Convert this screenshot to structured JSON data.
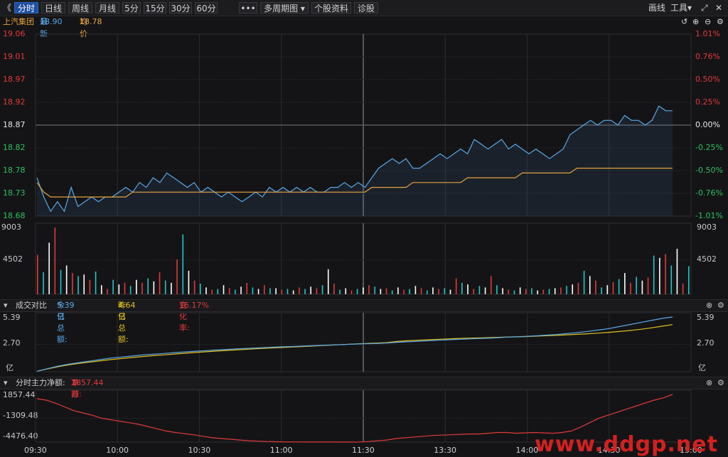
{
  "toolbar": {
    "back_glyph": "《",
    "tabs": [
      "分时",
      "日线",
      "周线",
      "月线",
      "5分",
      "15分",
      "30分",
      "60分"
    ],
    "active_tab": 0,
    "more": "•••",
    "multi_period": "多周期图",
    "stock_info": "个股资料",
    "diagnose": "诊股",
    "draw_line": "画线",
    "tools": "工具",
    "icon_expand": "expand-icon",
    "icon_close": "close-icon"
  },
  "quote": {
    "name": "上汽集团",
    "latest_label": "最新",
    "latest": "18.90",
    "avg_label": "均价",
    "avg": "18.78"
  },
  "price_axis": {
    "left": [
      "19.06",
      "19.01",
      "18.97",
      "18.92",
      "18.87",
      "18.82",
      "18.78",
      "18.73",
      "18.68"
    ],
    "right": [
      "1.01%",
      "0.76%",
      "0.50%",
      "0.25%",
      "0.00%",
      "-0.25%",
      "-0.50%",
      "-0.76%",
      "-1.01%"
    ],
    "prev_close": 18.87,
    "min": 18.68,
    "max": 19.06
  },
  "volume_axis": {
    "labels": [
      "9003",
      "4502"
    ],
    "max": 9003
  },
  "turnover_panel": {
    "title": "成交对比",
    "today_label": "今日总额:",
    "today": "5.39亿",
    "yesterday_label": "昨日总额:",
    "yesterday": "4.64亿",
    "change_label": "变化率:",
    "change": "16.17%",
    "axis": [
      "5.39",
      "2.70",
      "亿"
    ],
    "max": 5.39
  },
  "flow_panel": {
    "title": "分时主力净额:",
    "net_label": "净额:",
    "net": "1857.44万",
    "arrow": "↑",
    "axis": [
      "1857.44",
      "-1309.48",
      "-4476.40"
    ],
    "max": 1857.44,
    "min": -4476.4
  },
  "time_axis": [
    "09:30",
    "10:00",
    "10:30",
    "11:00",
    "11:30",
    "13:30",
    "14:00",
    "14:30",
    "15:00"
  ],
  "colors": {
    "up": "#e03a3a",
    "down": "#1ec8c8",
    "price": "#5aa8e8",
    "avg": "#e6a23c",
    "yesterday": "#e0c020",
    "neutral": "#ffffff"
  },
  "chart_data": {
    "type": "line",
    "x_ticks": [
      "09:30",
      "10:00",
      "10:30",
      "11:00",
      "11:30",
      "13:30",
      "14:00",
      "14:30",
      "15:00"
    ],
    "price": [
      18.76,
      18.72,
      18.69,
      18.71,
      18.69,
      18.74,
      18.7,
      18.71,
      18.72,
      18.71,
      18.72,
      18.72,
      18.73,
      18.74,
      18.73,
      18.75,
      18.74,
      18.76,
      18.75,
      18.77,
      18.76,
      18.75,
      18.74,
      18.75,
      18.73,
      18.74,
      18.73,
      18.72,
      18.73,
      18.72,
      18.71,
      18.72,
      18.73,
      18.72,
      18.74,
      18.73,
      18.74,
      18.73,
      18.74,
      18.73,
      18.74,
      18.73,
      18.73,
      18.74,
      18.74,
      18.75,
      18.74,
      18.75,
      18.74,
      18.76,
      18.78,
      18.79,
      18.8,
      18.79,
      18.8,
      18.78,
      18.78,
      18.79,
      18.8,
      18.81,
      18.8,
      18.81,
      18.82,
      18.81,
      18.84,
      18.83,
      18.82,
      18.83,
      18.84,
      18.82,
      18.83,
      18.82,
      18.81,
      18.82,
      18.81,
      18.8,
      18.81,
      18.82,
      18.85,
      18.86,
      18.87,
      18.88,
      18.87,
      18.88,
      18.88,
      18.87,
      18.89,
      18.88,
      18.88,
      18.87,
      18.88,
      18.91,
      18.9,
      18.9
    ],
    "avg": [
      18.75,
      18.73,
      18.72,
      18.72,
      18.72,
      18.72,
      18.72,
      18.72,
      18.72,
      18.72,
      18.72,
      18.72,
      18.72,
      18.72,
      18.73,
      18.73,
      18.73,
      18.73,
      18.73,
      18.73,
      18.73,
      18.73,
      18.73,
      18.73,
      18.73,
      18.73,
      18.73,
      18.73,
      18.73,
      18.73,
      18.73,
      18.73,
      18.73,
      18.73,
      18.73,
      18.73,
      18.73,
      18.73,
      18.73,
      18.73,
      18.73,
      18.73,
      18.73,
      18.73,
      18.73,
      18.73,
      18.73,
      18.73,
      18.73,
      18.74,
      18.74,
      18.74,
      18.74,
      18.74,
      18.74,
      18.75,
      18.75,
      18.75,
      18.75,
      18.75,
      18.75,
      18.75,
      18.75,
      18.76,
      18.76,
      18.76,
      18.76,
      18.76,
      18.76,
      18.76,
      18.76,
      18.77,
      18.77,
      18.77,
      18.77,
      18.77,
      18.77,
      18.77,
      18.77,
      18.78,
      18.78,
      18.78,
      18.78,
      18.78,
      18.78,
      18.78,
      18.78,
      18.78,
      18.78,
      18.78,
      18.78,
      18.78,
      18.78,
      18.78
    ],
    "turnover_today": [
      0.05,
      0.3,
      0.55,
      0.75,
      0.9,
      1.05,
      1.2,
      1.35,
      1.45,
      1.55,
      1.65,
      1.72,
      1.8,
      1.88,
      1.95,
      2.02,
      2.08,
      2.14,
      2.2,
      2.26,
      2.3,
      2.35,
      2.4,
      2.45,
      2.48,
      2.52,
      2.56,
      2.6,
      2.64,
      2.68,
      2.72,
      2.75,
      2.78,
      2.82,
      2.9,
      2.95,
      3.0,
      3.05,
      3.1,
      3.15,
      3.2,
      3.24,
      3.28,
      3.32,
      3.38,
      3.43,
      3.48,
      3.53,
      3.6,
      3.66,
      3.75,
      3.85,
      3.97,
      4.1,
      4.25,
      4.45,
      4.65,
      4.85,
      5.05,
      5.25,
      5.39
    ],
    "turnover_yesterday": [
      0.05,
      0.28,
      0.5,
      0.68,
      0.82,
      0.95,
      1.08,
      1.2,
      1.3,
      1.4,
      1.5,
      1.58,
      1.66,
      1.74,
      1.82,
      1.9,
      1.97,
      2.04,
      2.1,
      2.16,
      2.22,
      2.28,
      2.33,
      2.38,
      2.43,
      2.48,
      2.53,
      2.58,
      2.63,
      2.68,
      2.73,
      2.78,
      2.82,
      2.86,
      2.98,
      3.05,
      3.1,
      3.15,
      3.2,
      3.24,
      3.28,
      3.31,
      3.34,
      3.37,
      3.4,
      3.43,
      3.46,
      3.5,
      3.54,
      3.58,
      3.63,
      3.68,
      3.74,
      3.8,
      3.88,
      3.96,
      4.06,
      4.18,
      4.32,
      4.48,
      4.64
    ],
    "net_flow": [
      1300,
      1100,
      700,
      200,
      -300,
      -600,
      -900,
      -1300,
      -1500,
      -1700,
      -1900,
      -2100,
      -2400,
      -2700,
      -3000,
      -3200,
      -3350,
      -3500,
      -3700,
      -3900,
      -4000,
      -4100,
      -4200,
      -4300,
      -4350,
      -4400,
      -4430,
      -4450,
      -4460,
      -4470,
      -4470,
      -4470,
      -4470,
      -4476,
      -4476,
      -4470,
      -4400,
      -4300,
      -4200,
      -4000,
      -3900,
      -3800,
      -3700,
      -3600,
      -3550,
      -3500,
      -3450,
      -3400,
      -3400,
      -3300,
      -3200,
      -3200,
      -3300,
      -3250,
      -3200,
      -3250,
      -3300,
      -3200,
      -3000,
      -2500,
      -1900,
      -1300,
      -900,
      -500,
      -100,
      300,
      700,
      1100,
      1400,
      1857
    ],
    "volume": [
      5200,
      2900,
      6800,
      8800,
      3200,
      3800,
      2800,
      2400,
      2600,
      1900,
      3000,
      1200,
      700,
      1900,
      1300,
      1500,
      1100,
      1900,
      1500,
      2100,
      1700,
      2900,
      1800,
      1500,
      4600,
      7900,
      3100,
      1800,
      1400,
      900,
      600,
      700,
      1200,
      800,
      600,
      1000,
      1500,
      900,
      700,
      1200,
      800,
      800,
      600,
      700,
      500,
      900,
      700,
      1000,
      800,
      1200,
      3300,
      1400,
      600,
      800,
      500,
      700,
      900,
      1200,
      1000,
      700,
      800,
      500,
      900,
      600,
      700,
      1100,
      800,
      500,
      900,
      700,
      800,
      600,
      2100,
      1500,
      1300,
      700,
      1100,
      900,
      2400,
      1200,
      800,
      600,
      500,
      900,
      700,
      800,
      500,
      600,
      700,
      800,
      900,
      1100,
      1300,
      1500,
      3100,
      2400,
      1800,
      900,
      1200,
      1600,
      2000,
      2800,
      1500,
      2300,
      1800,
      2200,
      5100,
      4800,
      5300,
      3800,
      6000,
      1400,
      3700
    ],
    "title": "",
    "ylim": [
      18.68,
      19.06
    ]
  }
}
